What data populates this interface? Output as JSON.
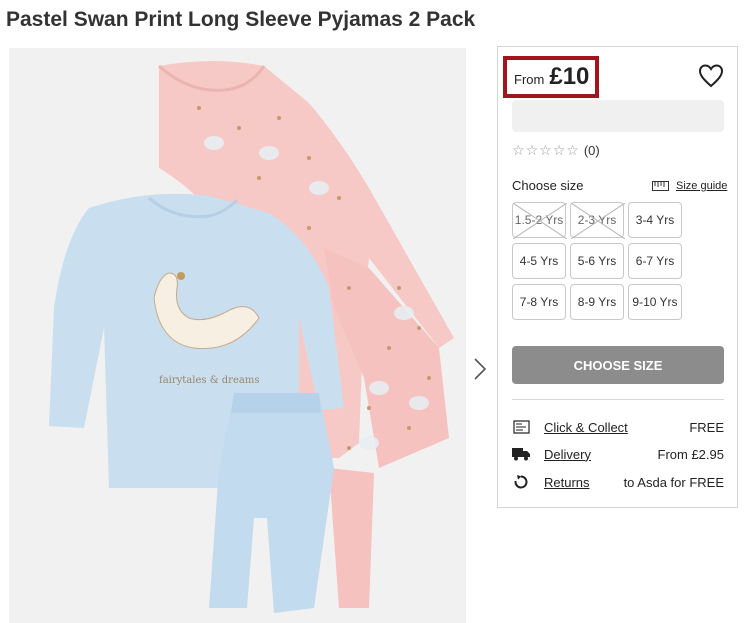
{
  "product": {
    "title": "Pastel Swan Print Long Sleeve Pyjamas 2 Pack",
    "image_alt": "Pastel swan print pyjamas, pink and blue"
  },
  "price": {
    "from_label": "From",
    "value": "£10",
    "highlight_color": "#a2151c"
  },
  "rating": {
    "stars_filled": 0,
    "stars_total": 5,
    "count_text": "(0)"
  },
  "size": {
    "label": "Choose size",
    "guide_label": "Size guide",
    "options": [
      {
        "label": "1.5-2 Yrs",
        "available": false
      },
      {
        "label": "2-3 Yrs",
        "available": false
      },
      {
        "label": "3-4 Yrs",
        "available": true
      },
      {
        "label": "4-5 Yrs",
        "available": true
      },
      {
        "label": "5-6 Yrs",
        "available": true
      },
      {
        "label": "6-7 Yrs",
        "available": true
      },
      {
        "label": "7-8 Yrs",
        "available": true
      },
      {
        "label": "8-9 Yrs",
        "available": true
      },
      {
        "label": "9-10 Yrs",
        "available": true
      }
    ]
  },
  "cta": {
    "label": "CHOOSE SIZE",
    "color": "#8c8c8c"
  },
  "delivery": [
    {
      "icon": "click-collect-icon",
      "link": "Click & Collect",
      "value": "FREE"
    },
    {
      "icon": "delivery-truck-icon",
      "link": "Delivery",
      "value": "From £2.95"
    },
    {
      "icon": "returns-icon",
      "link": "Returns",
      "value": "to Asda for FREE"
    }
  ]
}
